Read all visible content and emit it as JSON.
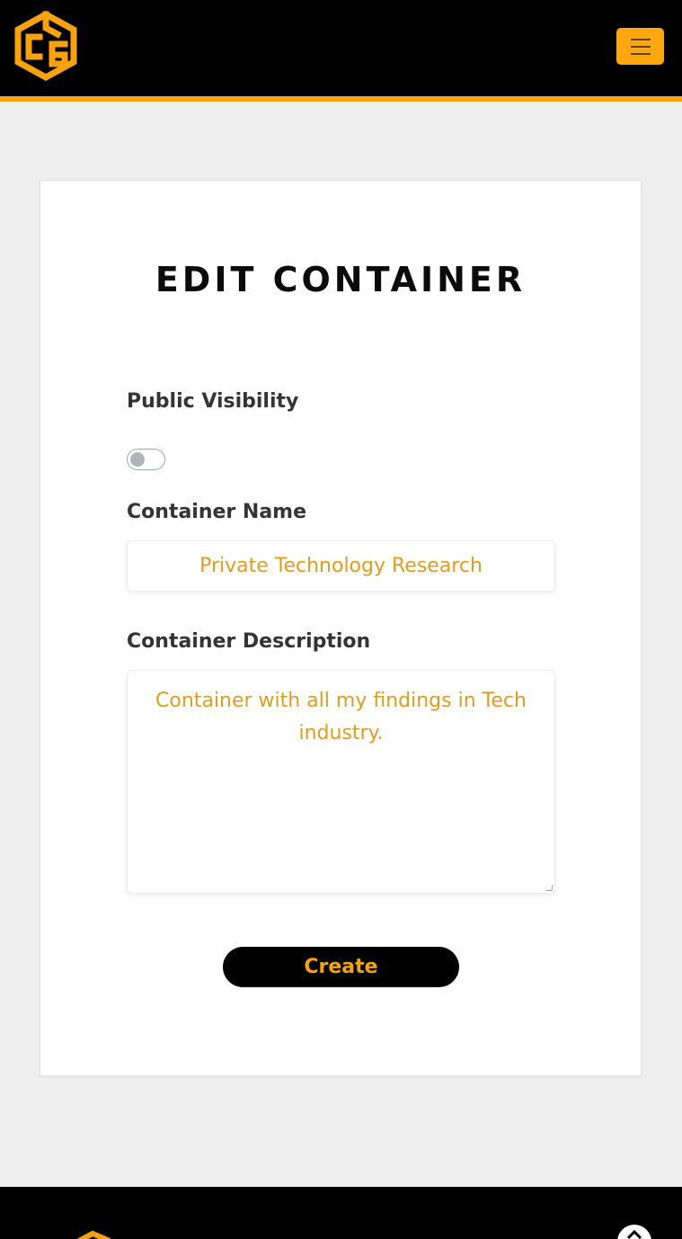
{
  "header": {
    "logo_icon": "cube-logo-icon",
    "menu_icon": "hamburger-menu-icon"
  },
  "form": {
    "title": "EDIT CONTAINER",
    "visibility_label": "Public Visibility",
    "visibility_on": false,
    "name_label": "Container Name",
    "name_value": "Private Technology Research",
    "description_label": "Container Description",
    "description_value": "Container with all my findings in Tech industry.",
    "submit_label": "Create"
  },
  "footer": {
    "logo_icon": "cube-logo-icon",
    "scroll_icon": "scroll-to-top-icon"
  },
  "colors": {
    "accent": "#f8a20f",
    "header_bg": "#000000",
    "page_bg": "#efeeee",
    "value_text": "#e09c1c"
  }
}
